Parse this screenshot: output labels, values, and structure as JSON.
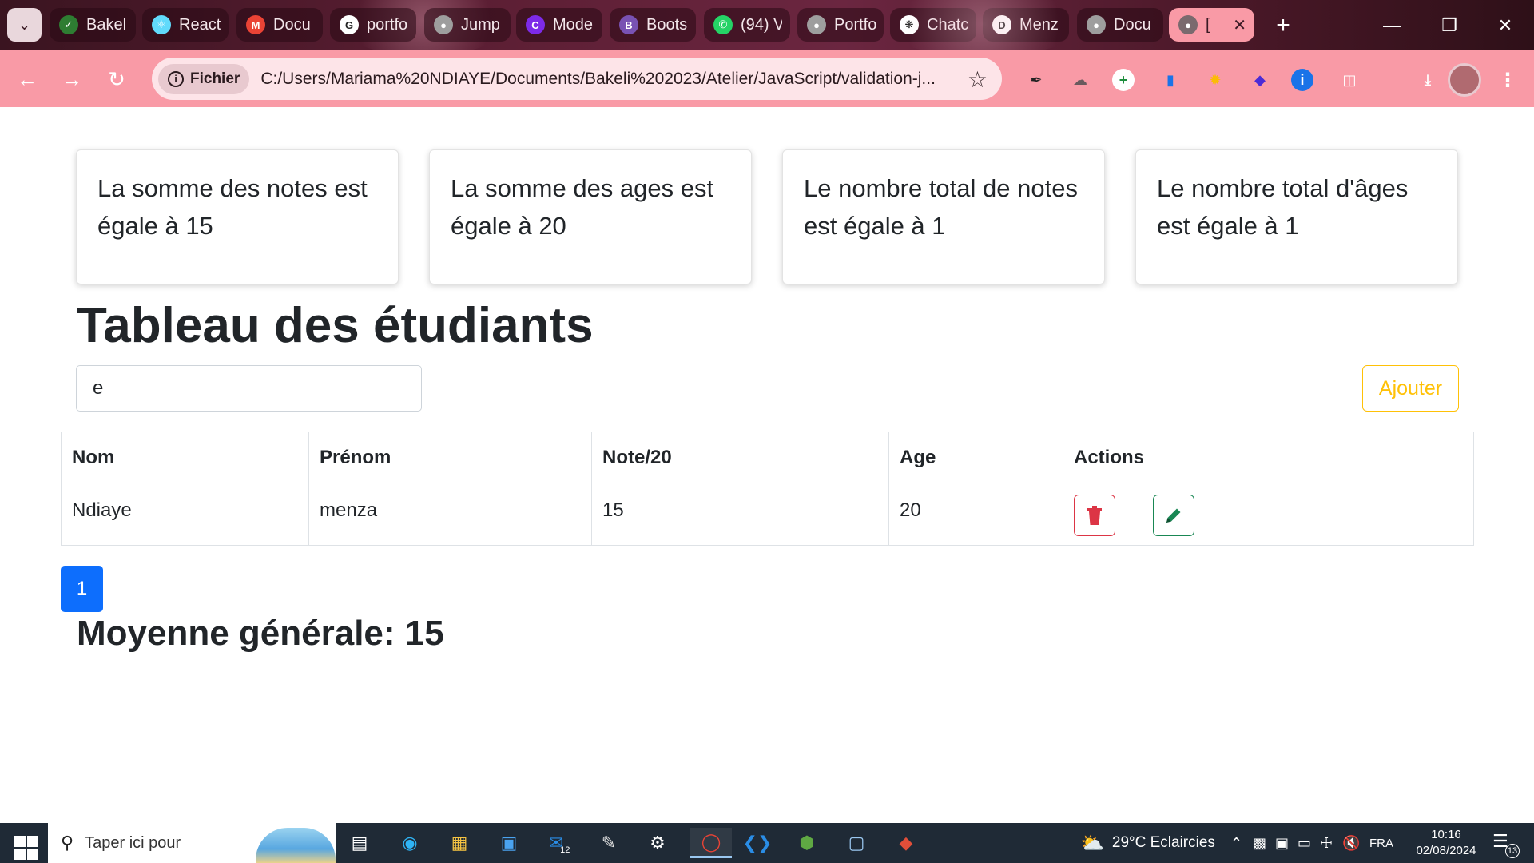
{
  "browser": {
    "tabs": [
      {
        "label": "Bakel",
        "icon": "bakeli-icon",
        "color": "#2e7d32"
      },
      {
        "label": "React",
        "icon": "react-icon",
        "color": "#61dafb"
      },
      {
        "label": "Docu",
        "icon": "gmail-icon",
        "color": "#ea4335"
      },
      {
        "label": "portfo",
        "icon": "google-icon",
        "color": "#ffffff"
      },
      {
        "label": "Jump",
        "icon": "globe-icon",
        "color": "#9e9e9e"
      },
      {
        "label": "Mode",
        "icon": "canva-icon",
        "color": "#7d2ae8"
      },
      {
        "label": "Boots",
        "icon": "bootstrap-icon",
        "color": "#7952b3"
      },
      {
        "label": "(94) V",
        "icon": "whatsapp-icon",
        "color": "#25d366"
      },
      {
        "label": "Portfo",
        "icon": "globe-icon",
        "color": "#9e9e9e"
      },
      {
        "label": "Chatc",
        "icon": "chatgpt-icon",
        "color": "#ffffff"
      },
      {
        "label": "Menz",
        "icon": "deka-icon",
        "color": "#ffffff"
      },
      {
        "label": "Docu",
        "icon": "globe-icon",
        "color": "#9e9e9e"
      }
    ],
    "active_tab": {
      "label": "[",
      "icon": "globe-icon"
    },
    "url_chip": "Fichier",
    "url": "C:/Users/Mariama%20NDIAYE/Documents/Bakeli%202023/Atelier/JavaScript/validation-j..."
  },
  "cards": [
    {
      "text": "La somme des notes est égale à 15"
    },
    {
      "text": "La somme des ages est égale à 20"
    },
    {
      "text": "Le nombre total de notes est égale à 1"
    },
    {
      "text": "Le nombre total d'âges est égale à 1"
    }
  ],
  "page": {
    "title": "Tableau des étudiants",
    "search_value": "e",
    "add_label": "Ajouter",
    "pagination_page": "1",
    "average": "Moyenne générale: 15"
  },
  "table": {
    "headers": [
      "Nom",
      "Prénom",
      "Note/20",
      "Age",
      "Actions"
    ],
    "rows": [
      {
        "nom": "Ndiaye",
        "prenom": "menza",
        "note": "15",
        "age": "20"
      }
    ]
  },
  "colors": {
    "primary": "#0d6efd",
    "warning": "#ffc107",
    "danger": "#dc3545",
    "success": "#198754",
    "browser_accent": "#f99aa6"
  },
  "taskbar": {
    "search_placeholder": "Taper ici pour",
    "mail_badge": "12",
    "weather": "29°C  Eclaircies",
    "language": "FRA",
    "time": "10:16",
    "date": "02/08/2024",
    "notification_count": "13"
  }
}
